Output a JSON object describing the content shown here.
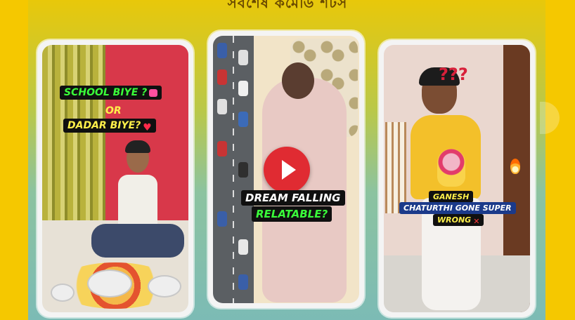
{
  "section": {
    "heading": "সর্বশেষ কমেডি শর্টস"
  },
  "cards": [
    {
      "captions": [
        "SCHOOL BIYE ?",
        "OR",
        "DADAR BIYE?"
      ]
    },
    {
      "captions": [
        "DREAM FALLING",
        "RELATABLE?"
      ],
      "play_icon": "play-icon"
    },
    {
      "captions": [
        "GANESH",
        "CHATURTHI GONE SUPER",
        "WRONG"
      ]
    }
  ],
  "colors": {
    "background": "#f5c800",
    "play_button": "#e02b32",
    "caption_green": "#3aff3a",
    "caption_yellow": "#fff04a"
  }
}
